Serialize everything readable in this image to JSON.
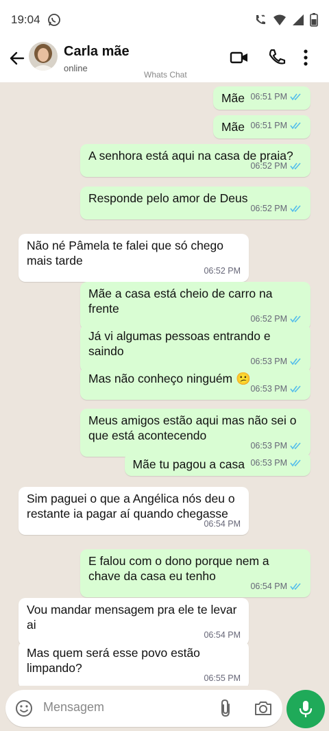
{
  "status_bar": {
    "time": "19:04"
  },
  "header": {
    "contact_name": "Carla mãe",
    "status": "online",
    "watermark": "Whats Chat"
  },
  "messages": [
    {
      "dir": "out",
      "text": "Mãe",
      "time": "06:51 PM"
    },
    {
      "dir": "out",
      "text": "Mãe",
      "time": "06:51 PM"
    },
    {
      "dir": "out",
      "text": "A senhora está aqui na casa de praia?",
      "time": "06:52 PM"
    },
    {
      "dir": "out",
      "text": "Responde pelo amor de Deus",
      "time": "06:52 PM"
    },
    {
      "dir": "in",
      "text": "Não né Pâmela te falei que só chego mais tarde",
      "time": "06:52 PM"
    },
    {
      "dir": "out",
      "text": "Mãe a casa está cheio de carro na frente",
      "time": "06:52 PM"
    },
    {
      "dir": "out",
      "text": "Já vi algumas pessoas entrando e saindo",
      "time": "06:53 PM"
    },
    {
      "dir": "out",
      "text": "Mas não conheço ninguém 😕",
      "time": "06:53 PM"
    },
    {
      "dir": "out",
      "text": "Meus amigos estão aqui mas não sei o que está acontecendo",
      "time": "06:53 PM"
    },
    {
      "dir": "out",
      "text": "Mãe tu pagou a casa",
      "time": "06:53 PM"
    },
    {
      "dir": "in",
      "text": "Sim paguei o que a Angélica nós deu o restante ia pagar aí quando chegasse",
      "time": "06:54 PM"
    },
    {
      "dir": "out",
      "text": "E falou com o dono porque nem a chave da casa eu tenho",
      "time": "06:54 PM"
    },
    {
      "dir": "in",
      "text": "Vou mandar mensagem pra ele te levar ai",
      "time": "06:54 PM"
    },
    {
      "dir": "in",
      "text": "Mas quem será esse povo estão limpando?",
      "time": "06:55 PM"
    }
  ],
  "composer": {
    "placeholder": "Mensagem"
  },
  "colors": {
    "outgoing_bubble": "#d9fdd3",
    "incoming_bubble": "#ffffff",
    "chat_background": "#ece5dd",
    "read_ticks": "#53bdeb",
    "mic_button": "#1faa59"
  },
  "icons": [
    "whatsapp-icon",
    "phone-vibrate-icon",
    "wifi-icon",
    "signal-icon",
    "battery-icon",
    "back-arrow-icon",
    "video-call-icon",
    "phone-icon",
    "more-options-icon",
    "emoji-icon",
    "attach-icon",
    "camera-icon",
    "mic-icon"
  ]
}
